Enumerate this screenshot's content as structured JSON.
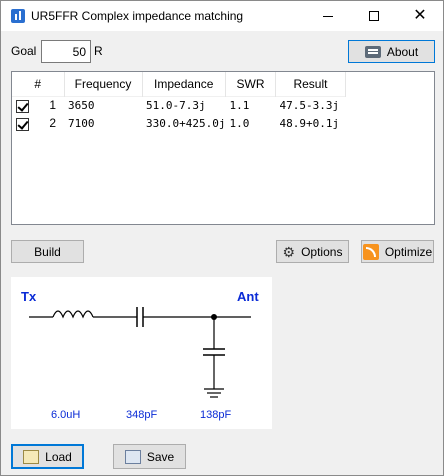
{
  "window": {
    "title": "UR5FFR Complex impedance matching"
  },
  "goal": {
    "label": "Goal",
    "value": "50",
    "unit": "R"
  },
  "buttons": {
    "about": "About",
    "build": "Build",
    "options": "Options",
    "optimize": "Optimize",
    "load": "Load",
    "save": "Save"
  },
  "table": {
    "columns": [
      "#",
      "Frequency",
      "Impedance",
      "SWR",
      "Result"
    ],
    "rows": [
      {
        "checked": true,
        "num": "1",
        "frequency": "3650",
        "impedance": "51.0-7.3j",
        "swr": "1.1",
        "result": "47.5-3.3j"
      },
      {
        "checked": true,
        "num": "2",
        "frequency": "7100",
        "impedance": "330.0+425.0j",
        "swr": "1.0",
        "result": "48.9+0.1j"
      }
    ]
  },
  "schematic": {
    "tx": "Tx",
    "ant": "Ant",
    "values": [
      "6.0uH",
      "348pF",
      "138pF"
    ],
    "accent": "#0a2bd6"
  }
}
